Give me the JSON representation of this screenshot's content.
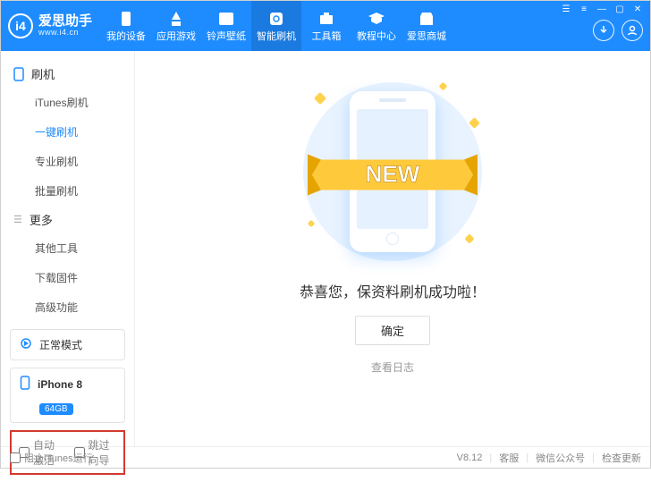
{
  "app": {
    "name": "爱思助手",
    "url": "www.i4.cn",
    "logoLetters": "i4"
  },
  "nav": [
    {
      "label": "我的设备"
    },
    {
      "label": "应用游戏"
    },
    {
      "label": "铃声壁纸"
    },
    {
      "label": "智能刷机"
    },
    {
      "label": "工具箱"
    },
    {
      "label": "教程中心"
    },
    {
      "label": "爱思商城"
    }
  ],
  "sidebar": {
    "group1": {
      "title": "刷机"
    },
    "items1": [
      {
        "label": "iTunes刷机"
      },
      {
        "label": "一键刷机"
      },
      {
        "label": "专业刷机"
      },
      {
        "label": "批量刷机"
      }
    ],
    "group2": {
      "title": "更多"
    },
    "items2": [
      {
        "label": "其他工具"
      },
      {
        "label": "下载固件"
      },
      {
        "label": "高级功能"
      }
    ],
    "mode": "正常模式",
    "device": {
      "name": "iPhone 8",
      "storage": "64GB"
    },
    "checks": {
      "autoActivate": "自动激活",
      "skipSetup": "跳过向导"
    }
  },
  "main": {
    "ribbon": "NEW",
    "successText": "恭喜您，保资料刷机成功啦！",
    "okButton": "确定",
    "viewLog": "查看日志"
  },
  "footer": {
    "blockItunes": "阻止iTunes运行",
    "version": "V8.12",
    "support": "客服",
    "wechat": "微信公众号",
    "update": "检查更新"
  }
}
